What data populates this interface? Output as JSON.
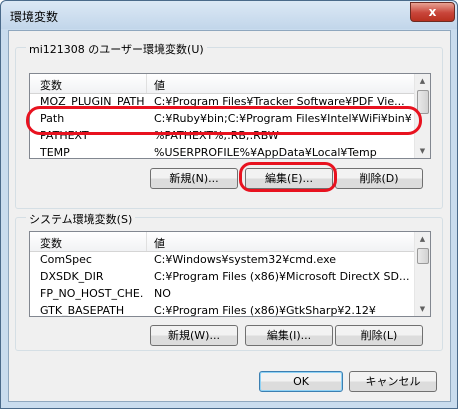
{
  "window": {
    "title": "環境変数",
    "close_glyph": "x"
  },
  "user_group": {
    "label": "mi121308 のユーザー環境変数(U)",
    "columns": [
      "変数",
      "値"
    ],
    "rows": [
      {
        "name": "MOZ_PLUGIN_PATH",
        "value": "C:¥Program Files¥Tracker Software¥PDF Vie..."
      },
      {
        "name": "Path",
        "value": "C:¥Ruby¥bin;C:¥Program Files¥Intel¥WiFi¥bin¥;..."
      },
      {
        "name": "PATHEXT",
        "value": "%PATHEXT%;.RB;.RBW"
      },
      {
        "name": "TEMP",
        "value": "%USERPROFILE%¥AppData¥Local¥Temp"
      }
    ],
    "buttons": {
      "new": "新規(N)...",
      "edit": "編集(E)...",
      "delete": "削除(D)"
    }
  },
  "system_group": {
    "label": "システム環境変数(S)",
    "columns": [
      "変数",
      "値"
    ],
    "rows": [
      {
        "name": "ComSpec",
        "value": "C:¥Windows¥system32¥cmd.exe"
      },
      {
        "name": "DXSDK_DIR",
        "value": "C:¥Program Files (x86)¥Microsoft DirectX SD..."
      },
      {
        "name": "FP_NO_HOST_CHE...",
        "value": "NO"
      },
      {
        "name": "GTK_BASEPATH",
        "value": "C:¥Program Files (x86)¥GtkSharp¥2.12¥"
      }
    ],
    "buttons": {
      "new": "新規(W)...",
      "edit": "編集(I)...",
      "delete": "削除(L)"
    }
  },
  "footer": {
    "ok": "OK",
    "cancel": "キャンセル"
  },
  "colors": {
    "annotation": "#e8121f",
    "close_button": "#c8453a"
  }
}
